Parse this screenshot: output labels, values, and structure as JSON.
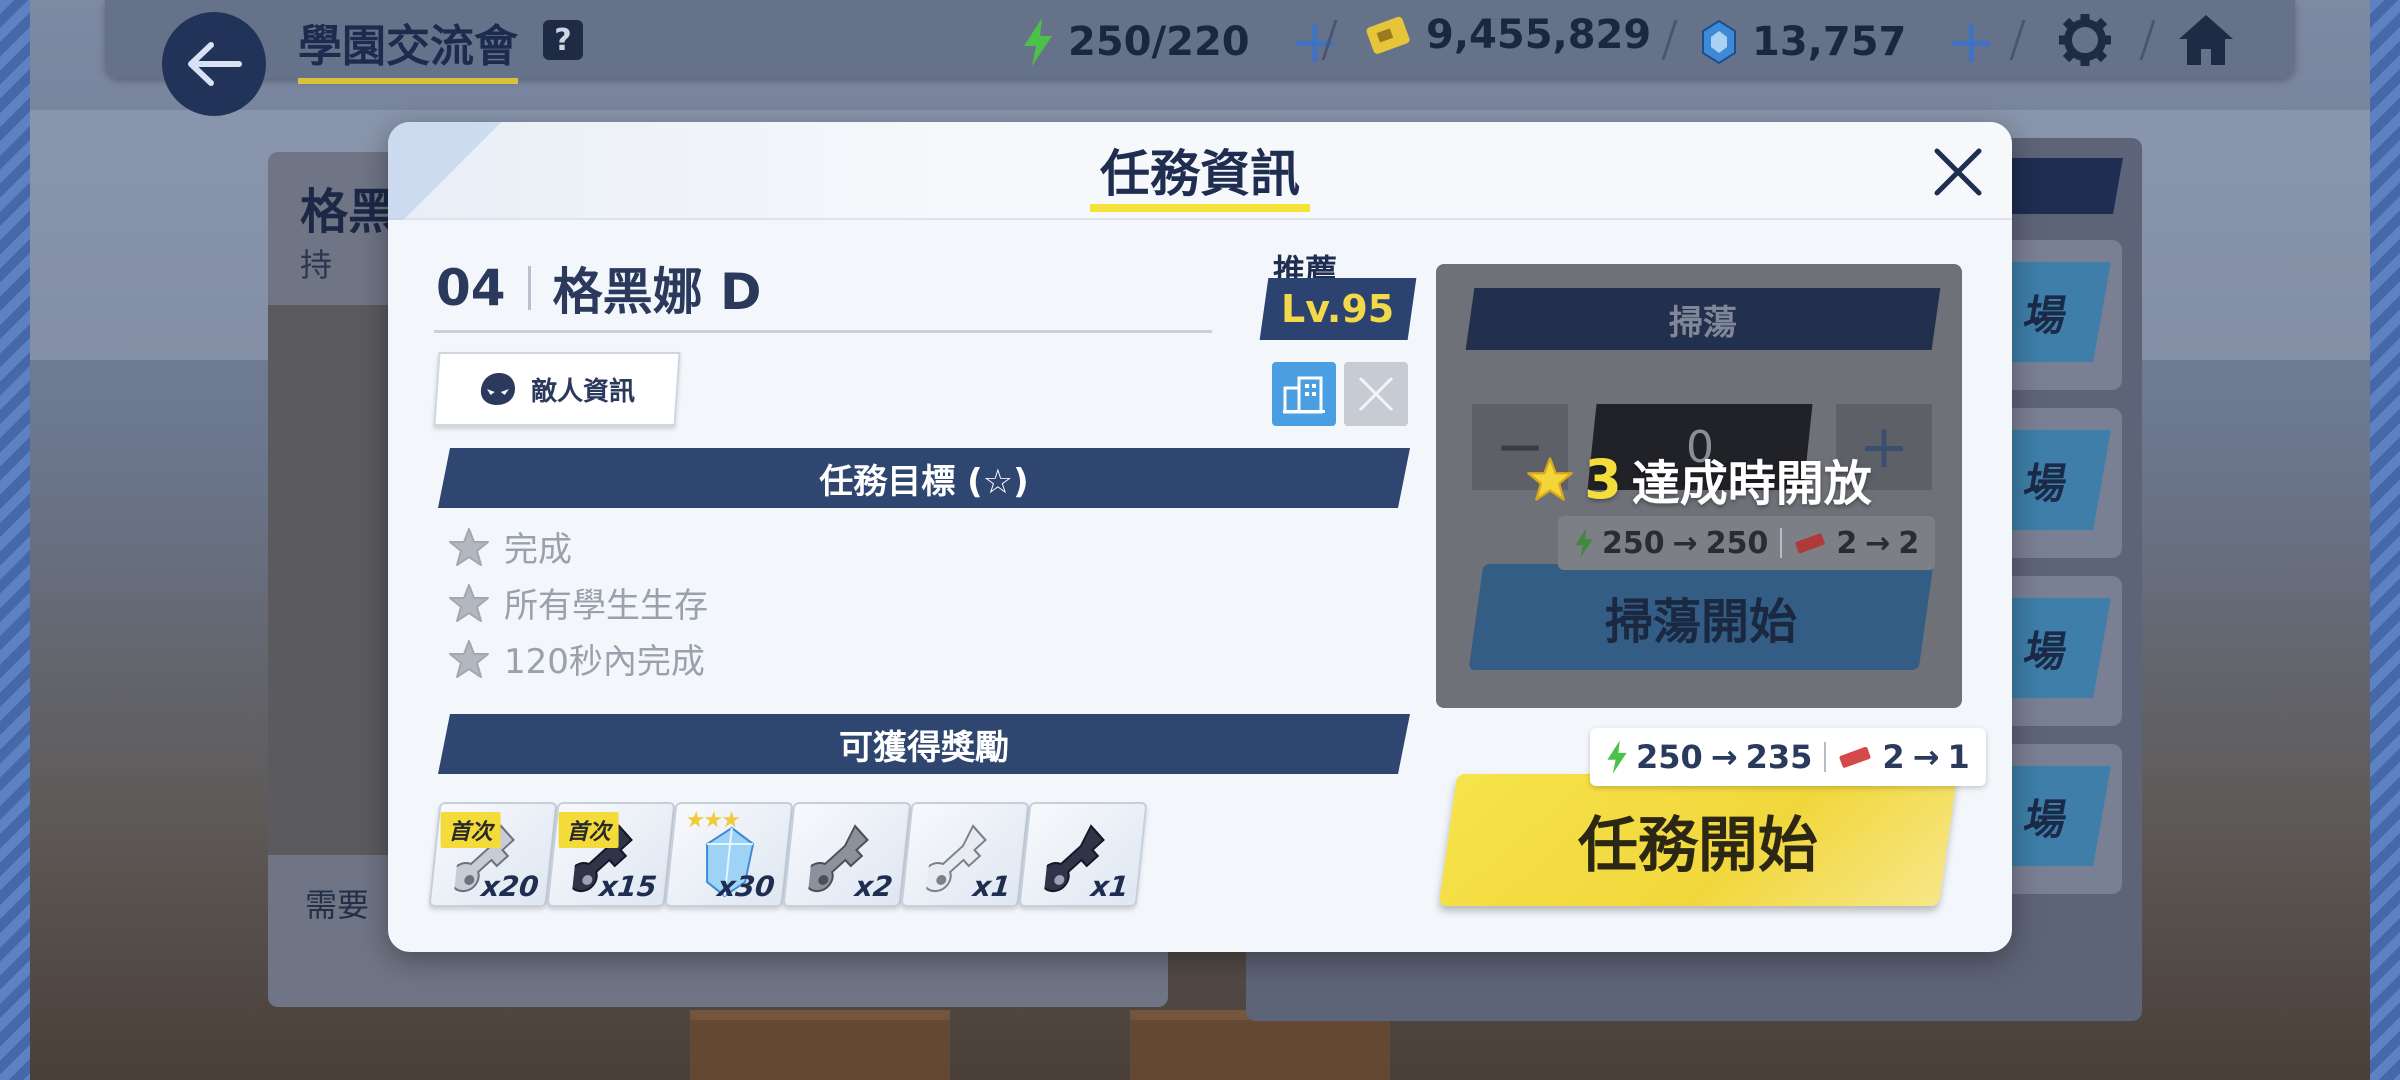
{
  "topbar": {
    "title": "學園交流會",
    "help": "?",
    "ap": "250/220",
    "credits": "9,455,829",
    "gems": "13,757"
  },
  "background": {
    "card_title": "格黑",
    "card_sub": "持",
    "card_need": "需要",
    "list_button": "場"
  },
  "modal": {
    "title": "任務資訊",
    "stage_number": "04",
    "stage_name": "格黑娜 D",
    "recommend_label": "推薦",
    "recommend_level": "Lv.95",
    "enemy_info_label": "敵人資訊",
    "goals_header": "任務目標 (☆)",
    "goals": [
      "完成",
      "所有學生生存",
      "120秒內完成"
    ],
    "rewards_header": "可獲得獎勵",
    "first_clear_label": "首次",
    "rewards": [
      {
        "item": "gray-key-icon",
        "qty": "x20",
        "badge": "first"
      },
      {
        "item": "dark-key-icon",
        "qty": "x15",
        "badge": "first"
      },
      {
        "item": "blue-crystal-icon",
        "qty": "x30",
        "badge": "stars"
      },
      {
        "item": "gray-key-icon",
        "qty": "x2",
        "badge": ""
      },
      {
        "item": "white-key-icon",
        "qty": "x1",
        "badge": ""
      },
      {
        "item": "dark-key-icon",
        "qty": "x1",
        "badge": ""
      }
    ]
  },
  "sweep": {
    "title": "掃蕩",
    "count": "0",
    "lock_stars": "3",
    "lock_text": "達成時開放",
    "ap_from": "250",
    "ap_to": "250",
    "ticket_from": "2",
    "ticket_to": "2",
    "button": "掃蕩開始"
  },
  "start": {
    "ap_from": "250",
    "ap_to": "235",
    "ticket_from": "2",
    "ticket_to": "1",
    "button": "任務開始"
  },
  "colors": {
    "accent_yellow": "#f4e13a",
    "navy": "#2f4670",
    "ap_green": "#4cc14a",
    "gem_blue": "#3f8ad6"
  }
}
